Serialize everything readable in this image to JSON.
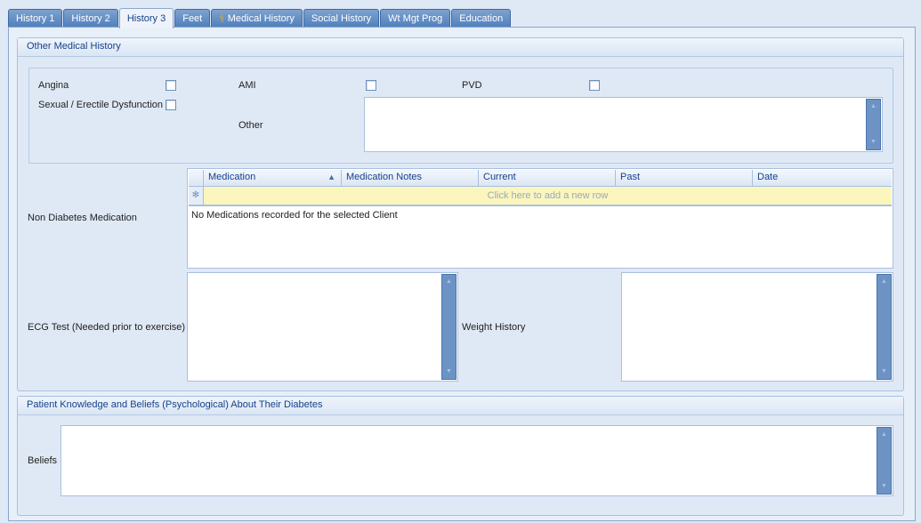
{
  "tabs": [
    {
      "label": "History 1",
      "active": false
    },
    {
      "label": "History 2",
      "active": false
    },
    {
      "label": "History 3",
      "active": true
    },
    {
      "label": "Feet",
      "active": false
    },
    {
      "label": "Medical History",
      "active": false,
      "icon": "caduceus-icon"
    },
    {
      "label": "Social History",
      "active": false
    },
    {
      "label": "Wt Mgt Prog",
      "active": false
    },
    {
      "label": "Education",
      "active": false
    }
  ],
  "other_medical": {
    "title": "Other Medical History",
    "angina_label": "Angina",
    "ami_label": "AMI",
    "pvd_label": "PVD",
    "sexual_label": "Sexual / Erectile Dysfunction",
    "other_label": "Other",
    "other_value": "",
    "non_diabetes_label": "Non Diabetes Medication",
    "ecg_label": "ECG Test (Needed prior to exercise)",
    "weight_label": "Weight History",
    "ecg_value": "",
    "weight_value": ""
  },
  "medication_grid": {
    "columns": [
      "Medication",
      "Medication Notes",
      "Current",
      "Past",
      "Date"
    ],
    "sort_column": "Medication",
    "sort_direction": "ascending",
    "new_row_text": "Click here to add a new row",
    "empty_text": "No Medications recorded for the selected Client"
  },
  "knowledge": {
    "title": "Patient Knowledge and Beliefs (Psychological) About Their Diabetes",
    "beliefs_label": "Beliefs",
    "beliefs_value": ""
  },
  "colors": {
    "tab_inactive": "#5a88c3",
    "tab_active_text": "#15428b",
    "new_row_bg": "#fbf6bd",
    "scrollbar": "#6d93c5"
  }
}
